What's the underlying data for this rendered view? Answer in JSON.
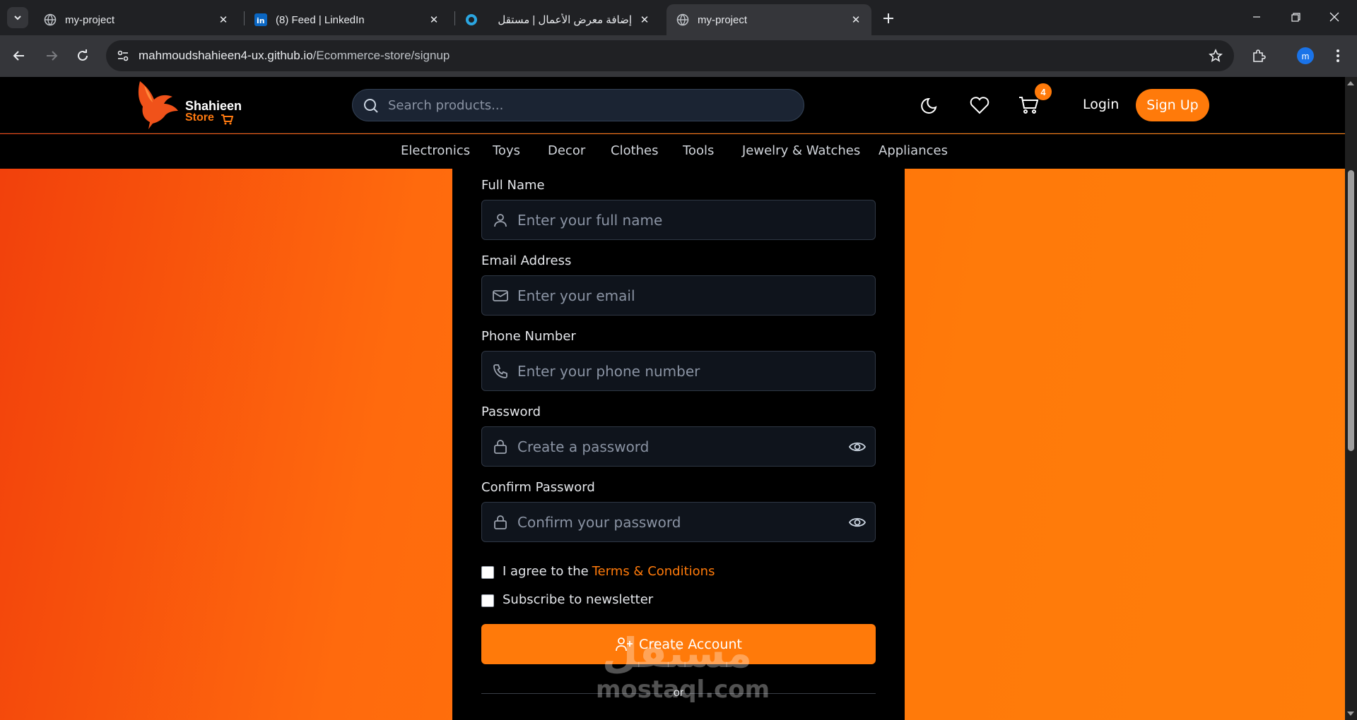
{
  "browser": {
    "tabs": [
      {
        "title": "my-project",
        "icon": "globe-icon",
        "active": false
      },
      {
        "title": "(8) Feed | LinkedIn",
        "icon": "linkedin-icon",
        "active": false
      },
      {
        "title": "إضافة معرض الأعمال | مستقل",
        "icon": "mostaql-icon",
        "active": false
      },
      {
        "title": "my-project",
        "icon": "globe-icon",
        "active": true
      }
    ],
    "url_host": "mahmoudshahieen4-ux.github.io",
    "url_path": "/Ecommerce-store/signup",
    "profile_initial": "m"
  },
  "header": {
    "logo_line1": "Shahieen",
    "logo_line2": "Store",
    "search_placeholder": "Search products...",
    "cart_count": "4",
    "login_label": "Login",
    "signup_label": "Sign Up"
  },
  "categories": [
    "Electronics",
    "Toys",
    "Decor",
    "Clothes",
    "Tools",
    "Jewelry & Watches",
    "Appliances"
  ],
  "form": {
    "full_name": {
      "label": "Full Name",
      "placeholder": "Enter your full name",
      "icon": "user-icon"
    },
    "email": {
      "label": "Email Address",
      "placeholder": "Enter your email",
      "icon": "mail-icon"
    },
    "phone": {
      "label": "Phone Number",
      "placeholder": "Enter your phone number",
      "icon": "phone-icon"
    },
    "password": {
      "label": "Password",
      "placeholder": "Create a password",
      "icon": "lock-icon"
    },
    "confirm_password": {
      "label": "Confirm Password",
      "placeholder": "Confirm your password",
      "icon": "lock-icon"
    },
    "agree_text": "I agree to the",
    "terms_link": "Terms & Conditions",
    "newsletter_text": "Subscribe to newsletter",
    "create_button": "Create Account",
    "or_text": "or"
  },
  "watermark": {
    "arabic": "مستقل",
    "latin": "mostaql.com"
  },
  "colors": {
    "accent": "#ff7a0a",
    "page_background": "#000000",
    "gradient_left": "#f13f0c",
    "gradient_right": "#ff7d0a"
  }
}
